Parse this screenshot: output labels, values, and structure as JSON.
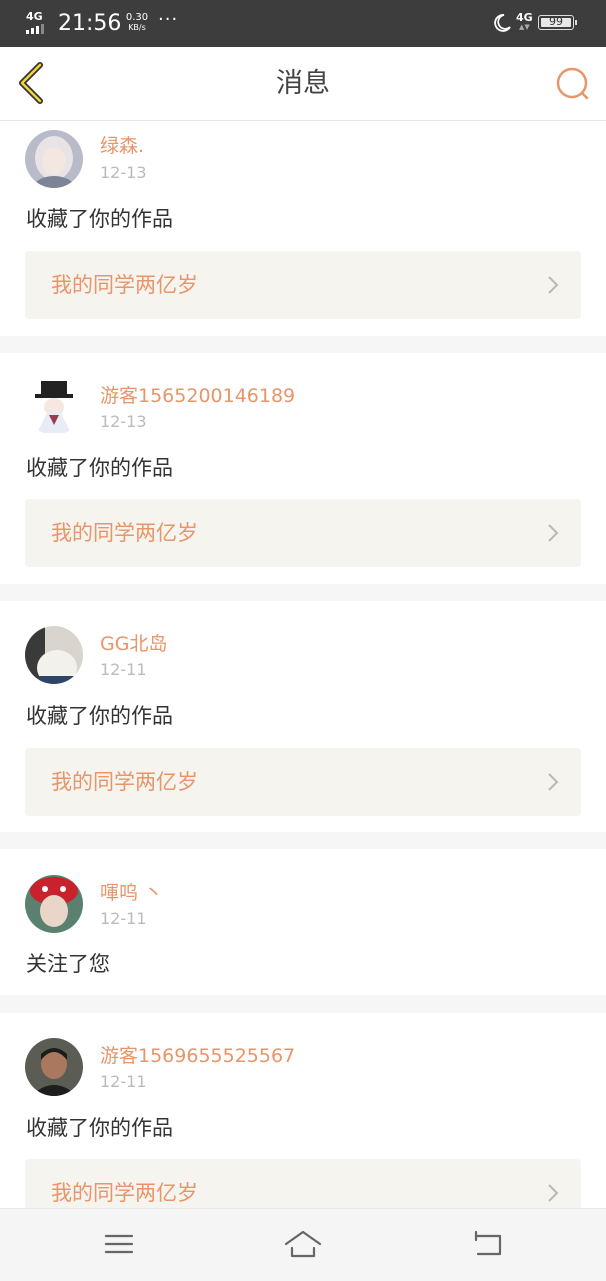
{
  "status_bar": {
    "network_left": "4G",
    "time": "21:56",
    "speed_value": "0.30",
    "speed_unit": "KB/s",
    "more_dots": "···",
    "network_right": "4G",
    "battery": "99",
    "icons": [
      "signal-icon",
      "moon-icon",
      "battery-icon"
    ]
  },
  "header": {
    "title": "消息",
    "back_icon": "chevron-left-icon",
    "search_icon": "search-icon",
    "accent_color": "#e8956a"
  },
  "notifications": [
    {
      "user": "绿森.",
      "date": "12-13",
      "action": "收藏了你的作品",
      "work": "我的同学两亿岁"
    },
    {
      "user": "游客1565200146189",
      "date": "12-13",
      "action": "收藏了你的作品",
      "work": "我的同学两亿岁"
    },
    {
      "user": "GG北岛",
      "date": "12-11",
      "action": "收藏了你的作品",
      "work": "我的同学两亿岁"
    },
    {
      "user": "喗呜 丶",
      "date": "12-11",
      "action": "关注了您"
    },
    {
      "user": "游客1569655525567",
      "date": "12-11",
      "action": "收藏了你的作品",
      "work": "我的同学两亿岁"
    }
  ],
  "bottom_nav": [
    "menu-icon",
    "home-icon",
    "back-icon"
  ]
}
